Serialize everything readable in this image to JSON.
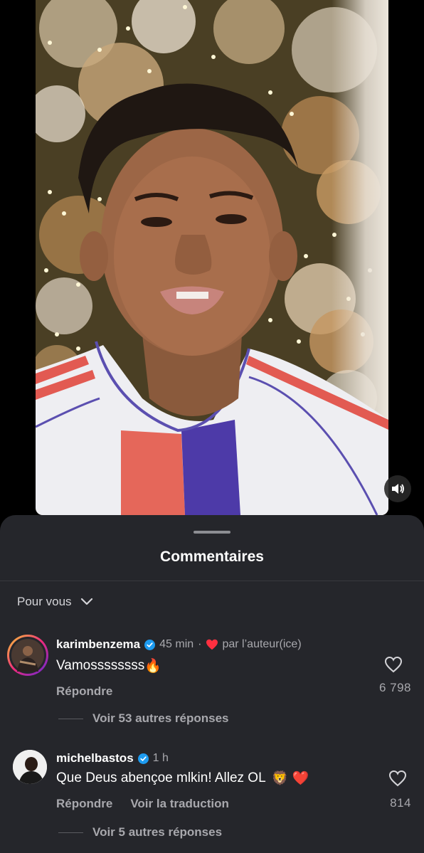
{
  "sheet": {
    "title": "Commentaires",
    "sort_label": "Pour vous"
  },
  "comments": [
    {
      "username": "karimbenzema",
      "time": "45 min",
      "separator": "·",
      "liked_by_author": "par l’auteur(ice)",
      "text": "Vamossssssss",
      "emoji": "🔥",
      "reply_label": "Répondre",
      "likes": "6 798",
      "view_replies": "Voir 53 autres réponses"
    },
    {
      "username": "michelbastos",
      "time": "1 h",
      "text": "Que Deus abençoe mlkin! Allez OL",
      "emoji": "🦁 ❤️",
      "reply_label": "Répondre",
      "translate_label": "Voir la traduction",
      "likes": "814",
      "view_replies": "Voir 5 autres réponses"
    }
  ],
  "colors": {
    "sheet_bg": "#25262b",
    "verified": "#1d9bf0",
    "heart_red": "#ff3040",
    "secondary_text": "#a8a8ad"
  },
  "icons": [
    "speaker-icon",
    "chevron-down-icon",
    "verified-badge-icon",
    "red-heart-icon",
    "like-heart-icon"
  ]
}
